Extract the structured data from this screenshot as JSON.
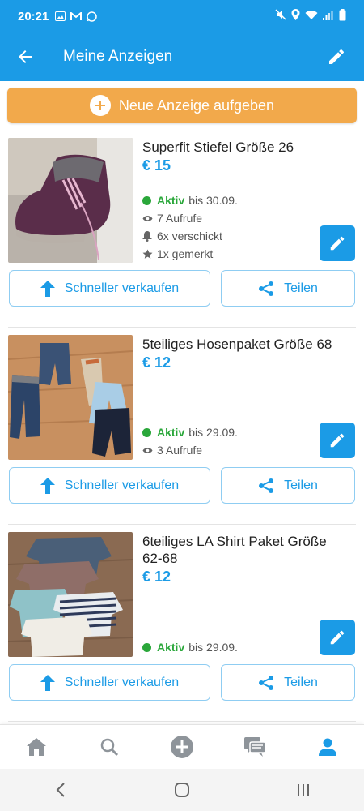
{
  "status_bar": {
    "time": "20:21",
    "battery_icon": "battery-icon",
    "wifi_icon": "wifi-icon"
  },
  "header": {
    "title": "Meine Anzeigen"
  },
  "new_ad_button": {
    "label": "Neue Anzeige aufgeben"
  },
  "ads": [
    {
      "title": "Superfit Stiefel Größe 26",
      "price": "€ 15",
      "status": "Aktiv",
      "until": "bis 30.09.",
      "views": "7 Aufrufe",
      "sent": "6x verschickt",
      "saved": "1x gemerkt",
      "sell_label": "Schneller verkaufen",
      "share_label": "Teilen"
    },
    {
      "title": "5teiliges Hosenpaket Größe 68",
      "price": "€ 12",
      "status": "Aktiv",
      "until": "bis 29.09.",
      "views": "3 Aufrufe",
      "sell_label": "Schneller verkaufen",
      "share_label": "Teilen"
    },
    {
      "title": "6teiliges LA Shirt Paket Größe 62-68",
      "price": "€ 12",
      "status": "Aktiv",
      "until": "bis 29.09.",
      "sell_label": "Schneller verkaufen",
      "share_label": "Teilen"
    }
  ],
  "colors": {
    "primary": "#1b9be6",
    "accent_orange": "#f2a94b",
    "active_green": "#2aa73a"
  }
}
